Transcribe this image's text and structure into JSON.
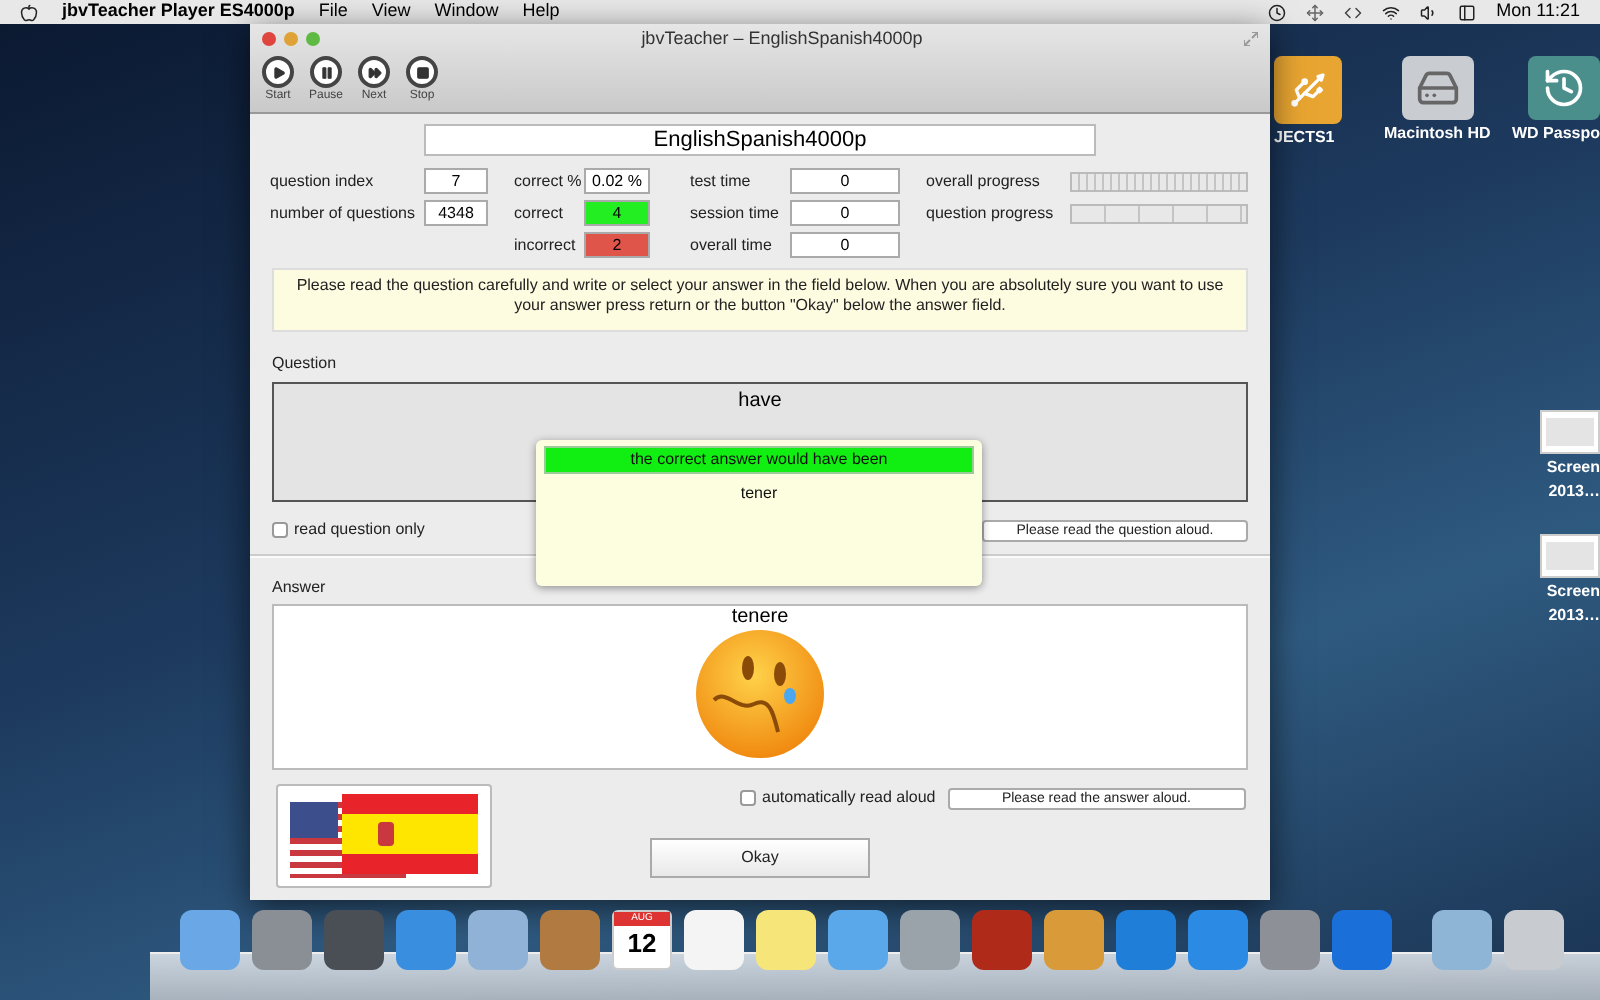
{
  "menu_bar": {
    "app_name": "jbvTeacher Player ES4000p",
    "menus": [
      "File",
      "View",
      "Window",
      "Help"
    ],
    "clock": "Mon 11:21"
  },
  "desktop_icons": [
    {
      "kind": "usb",
      "lines": [
        "JECTS1"
      ]
    },
    {
      "kind": "disk",
      "lines": [
        "Macintosh HD"
      ]
    },
    {
      "kind": "backup",
      "lines": [
        "WD Passpo"
      ]
    },
    {
      "kind": "screenshot",
      "lines": [
        "Screen",
        "2013…"
      ]
    },
    {
      "kind": "screenshot",
      "lines": [
        "Screen",
        "2013…"
      ]
    }
  ],
  "window": {
    "title": "jbvTeacher – EnglishSpanish4000p",
    "toolbar": [
      {
        "kind": "start",
        "label": "Start"
      },
      {
        "kind": "pause",
        "label": "Pause"
      },
      {
        "kind": "next",
        "label": "Next"
      },
      {
        "kind": "stop",
        "label": "Stop"
      }
    ],
    "deck_name": "EnglishSpanish4000p",
    "stat_columns": [
      [
        {
          "kind": "field",
          "label": "question index",
          "value": "7"
        },
        {
          "kind": "field",
          "label": "number of questions",
          "value": "4348"
        }
      ],
      [
        {
          "kind": "field",
          "label": "correct %",
          "value": "0.02 %"
        },
        {
          "kind": "field",
          "label": "correct",
          "value": "4",
          "color": "#22ee22"
        },
        {
          "kind": "field",
          "label": "incorrect",
          "value": "2",
          "color": "#e0554a"
        }
      ],
      [
        {
          "kind": "field",
          "label": "test time",
          "value": "0"
        },
        {
          "kind": "field",
          "label": "session time",
          "value": "0"
        },
        {
          "kind": "field",
          "label": "overall time",
          "value": "0"
        }
      ],
      [
        {
          "kind": "meter",
          "label": "overall progress",
          "level": 0
        },
        {
          "kind": "steps",
          "label": "question progress",
          "level": 0
        }
      ]
    ],
    "instructions": "Please read the question carefully and write or select your answer in the field below. When you are absolutely sure you want to use your answer press return or the button \"Okay\" below the answer field.",
    "question": {
      "heading": "Question",
      "text": "have",
      "checkbox": {
        "label": "read question only",
        "checked": false
      },
      "read_aloud_button": "Please read the question aloud."
    },
    "feedback_popup": {
      "header": "the correct answer would have been",
      "answer": "tener"
    },
    "answer": {
      "heading": "Answer",
      "text": "tenere",
      "checkbox": {
        "label": "automatically read aloud",
        "checked": false
      },
      "read_aloud_button": "Please read the answer aloud."
    },
    "okay_button": "Okay"
  },
  "dock": {
    "calendar_month": "AUG",
    "calendar_day": "12"
  }
}
